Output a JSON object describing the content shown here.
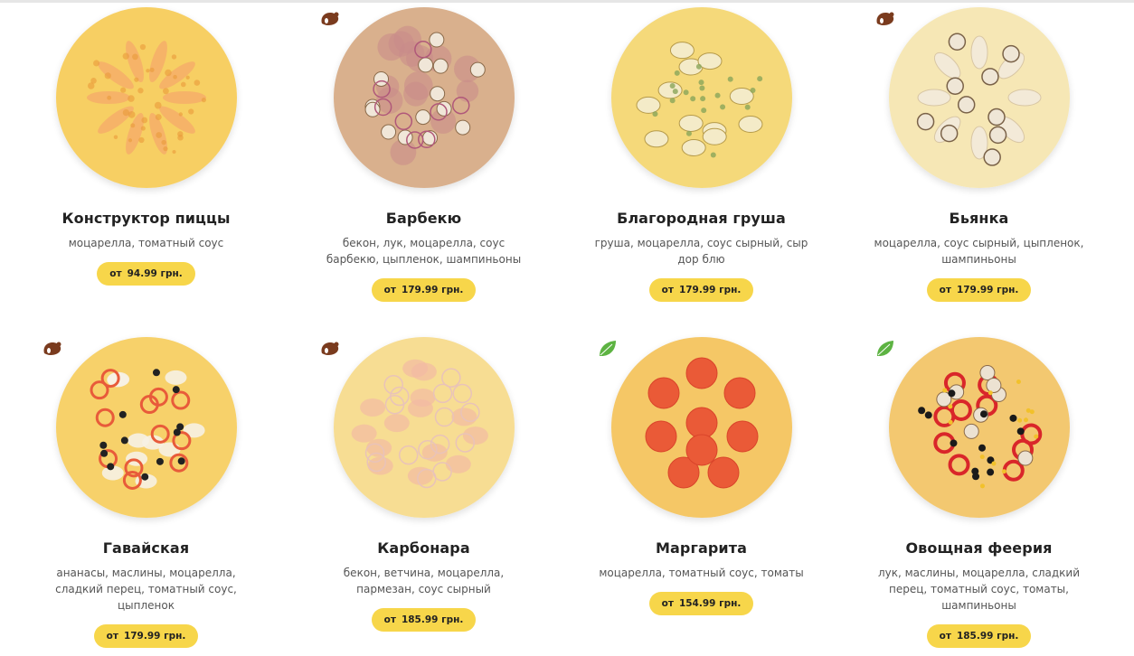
{
  "products": [
    {
      "name": "Конструктор пиццы",
      "desc": "моцарелла, томатный соус",
      "price_prefix": "от",
      "price": "94.99 грн.",
      "badge": "",
      "crust": "#f0b848",
      "cheese": "#f7cf63",
      "topping": "#f6a96a",
      "style": "constructor"
    },
    {
      "name": "Барбекю",
      "desc": "бекон, лук, моцарелла, соус барбекю, цыпленок, шампиньоны",
      "price_prefix": "от",
      "price": "179.99 грн.",
      "badge": "meat-icon",
      "crust": "#c98a3c",
      "cheese": "#d9b08d",
      "topping": "#f0e6d8",
      "style": "bbq"
    },
    {
      "name": "Благородная груша",
      "desc": "груша, моцарелла, соус сырный, сыр дор блю",
      "price_prefix": "от",
      "price": "179.99 грн.",
      "badge": "",
      "crust": "#efb54b",
      "cheese": "#f5d97a",
      "topping": "#f4ebc8",
      "style": "pear"
    },
    {
      "name": "Бьянка",
      "desc": "моцарелла, соус сырный, цыпленок, шампиньоны",
      "price_prefix": "от",
      "price": "179.99 грн.",
      "badge": "meat-icon",
      "crust": "#efc06a",
      "cheese": "#f6e7b5",
      "topping": "#efe3cf",
      "style": "bianca"
    },
    {
      "name": "Гавайская",
      "desc": "ананасы, маслины, моцарелла, сладкий перец, томатный соус, цыпленок",
      "price_prefix": "от",
      "price": "179.99 грн.",
      "badge": "meat-icon",
      "crust": "#efb34d",
      "cheese": "#f7d16a",
      "topping": "#e85b3a",
      "style": "hawaii"
    },
    {
      "name": "Карбонара",
      "desc": "бекон, ветчина, моцарелла, пармезан, соус сырный",
      "price_prefix": "от",
      "price": "185.99 грн.",
      "badge": "meat-icon",
      "crust": "#f1c35e",
      "cheese": "#f7dd93",
      "topping": "#f2b9a5",
      "style": "carbonara"
    },
    {
      "name": "Маргарита",
      "desc": "моцарелла, томатный соус, томаты",
      "price_prefix": "от",
      "price": "154.99 грн.",
      "badge": "leaf-icon",
      "crust": "#f0ae4c",
      "cheese": "#f5c766",
      "topping": "#ea5a37",
      "style": "margarita"
    },
    {
      "name": "Овощная феерия",
      "desc": "лук, маслины, моцарелла, сладкий перец, томатный соус, томаты, шампиньоны",
      "price_prefix": "от",
      "price": "185.99 грн.",
      "badge": "leaf-icon",
      "crust": "#eea94a",
      "cheese": "#f3c870",
      "topping": "#d9262a",
      "style": "veggie"
    }
  ],
  "colors": {
    "price_bg": "#f7d64a",
    "meat_badge": "#7a3b1e",
    "leaf_badge": "#5db342"
  }
}
